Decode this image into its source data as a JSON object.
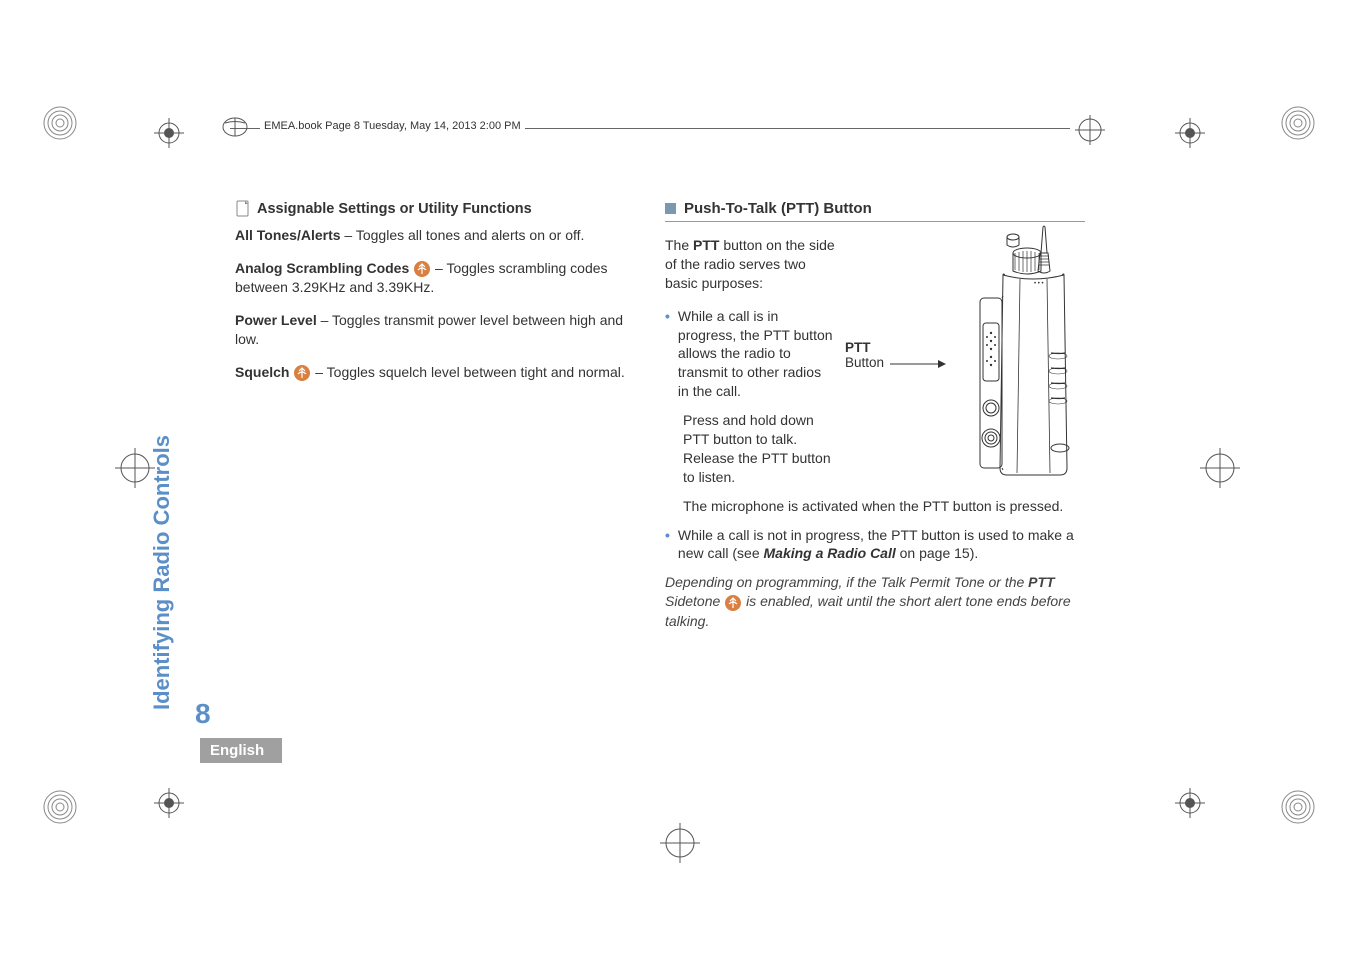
{
  "header": {
    "text": "EMEA.book  Page 8  Tuesday, May 14, 2013  2:00 PM"
  },
  "sidebar": {
    "title": "Identifying Radio Controls",
    "page_number": "8",
    "language": "English"
  },
  "left": {
    "heading": "Assignable Settings or Utility Functions",
    "items": {
      "tones_label": "All Tones/Alerts",
      "tones_text": " – Toggles all tones and alerts on or off.",
      "scramble_label": "Analog Scrambling Codes",
      "scramble_text_1": " – Toggles scrambling codes between 3.29KHz and 3.39KHz.",
      "power_label": "Power Level",
      "power_text": " – Toggles transmit power level between high and low.",
      "squelch_label": "Squelch",
      "squelch_text": " – Toggles squelch level between tight and normal."
    }
  },
  "right": {
    "heading": "Push-To-Talk (PTT) Button",
    "intro_1": "The ",
    "intro_bold_1": "PTT",
    "intro_2": " button on the side of the radio serves two basic purposes:",
    "bullet1_1": "While a call is in progress, the ",
    "bullet1_bold": "PTT",
    "bullet1_2": " button allows the radio to transmit to other radios in the call.",
    "sub1_1": "Press and hold down ",
    "sub1_bold1": "PTT",
    "sub1_2": " button to talk. Release the ",
    "sub1_bold2": "PTT",
    "sub1_3": " button to listen.",
    "sub2_1": "The microphone is activated when the ",
    "sub2_bold": "PTT",
    "sub2_2": " button is pressed.",
    "bullet2_1": "While a call is not in progress, the ",
    "bullet2_bold": "PTT",
    "bullet2_2": " button is used to make a new call (see ",
    "bullet2_ref": "Making a Radio Call",
    "bullet2_3": " on page 15).",
    "note_1": "Depending on programming, if the Talk Permit Tone or the ",
    "note_bold1": "PTT",
    "note_2": " Sidetone ",
    "note_3": " is enabled, wait until the short alert tone ends before talking.",
    "ptt_label": "PTT",
    "ptt_sublabel": "Button"
  }
}
